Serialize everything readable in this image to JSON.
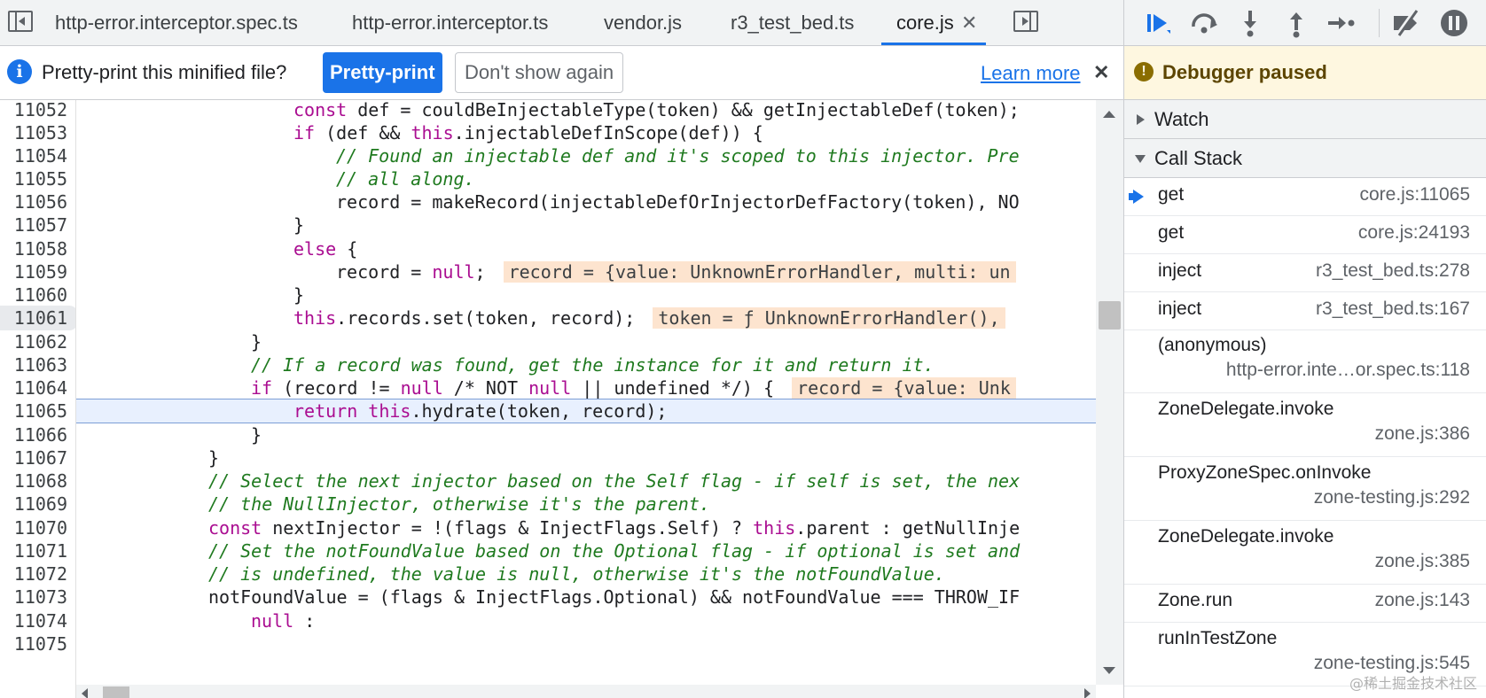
{
  "editor": {
    "tabs": [
      {
        "label": "http-error.interceptor.spec.ts",
        "active": false
      },
      {
        "label": "http-error.interceptor.ts",
        "active": false
      },
      {
        "label": "vendor.js",
        "active": false
      },
      {
        "label": "r3_test_bed.ts",
        "active": false
      },
      {
        "label": "core.js",
        "active": true
      }
    ],
    "tab_close_glyph": "✕",
    "left_toggle_icon": "toggle-navigator-icon",
    "right_toggle_icon": "toggle-debugger-icon"
  },
  "infobar": {
    "icon": "info-icon",
    "icon_glyph": "i",
    "message": "Pretty-print this minified file?",
    "primary_button": "Pretty-print",
    "secondary_button": "Don't show again",
    "link": "Learn more",
    "close_glyph": "✕"
  },
  "code": {
    "current_line": "11061",
    "line_numbers": [
      "11052",
      "11053",
      "11054",
      "11055",
      "11056",
      "11057",
      "11058",
      "11059",
      "11060",
      "11061",
      "11062",
      "11063",
      "11064",
      "11065",
      "11066",
      "11067",
      "11068",
      "11069",
      "11070",
      "11071",
      "11072",
      "11073",
      "11074",
      "11075"
    ],
    "lines": [
      "const def = couldBeInjectableType(token) && getInjectableDef(token);",
      "if (def && this.injectableDefInScope(def)) {",
      "// Found an injectable def and it's scoped to this injector. Pre",
      "// all along.",
      "record = makeRecord(injectableDefOrInjectorDefFactory(token), NO",
      "}",
      "else {",
      "record = null;",
      "}",
      "this.records.set(token, record);",
      "}",
      "// If a record was found, get the instance for it and return it.",
      "if (record != null /* NOT null || undefined */) {",
      "return this.hydrate(token, record);",
      "}",
      "}",
      "// Select the next injector based on the Self flag - if self is set, the nex",
      "// the NullInjector, otherwise it's the parent.",
      "const nextInjector = !(flags & InjectFlags.Self) ? this.parent : getNullInje",
      "// Set the notFoundValue based on the Optional flag - if optional is set and",
      "// is undefined, the value is null, otherwise it's the notFoundValue.",
      "notFoundValue = (flags & InjectFlags.Optional) && notFoundValue === THROW_IF",
      "null :",
      ""
    ],
    "inline_values": {
      "l11059": "record = {value: UnknownErrorHandler, multi: un",
      "l11061": "token = ƒ UnknownErrorHandler(),",
      "l11064": "record = {value: Unk"
    }
  },
  "debugger": {
    "toolbar_icons": [
      "resume-icon",
      "step-over-icon",
      "step-into-icon",
      "step-out-icon",
      "step-icon",
      "deactivate-breakpoints-icon",
      "pause-on-exceptions-icon"
    ],
    "paused_text": "Debugger paused",
    "watch_label": "Watch",
    "call_stack_label": "Call Stack",
    "frames": [
      {
        "name": "get",
        "loc": "core.js:11065",
        "current": true
      },
      {
        "name": "get",
        "loc": "core.js:24193"
      },
      {
        "name": "inject",
        "loc": "r3_test_bed.ts:278"
      },
      {
        "name": "inject",
        "loc": "r3_test_bed.ts:167"
      },
      {
        "name": "(anonymous)",
        "loc": "http-error.inte…or.spec.ts:118"
      },
      {
        "name": "ZoneDelegate.invoke",
        "loc": "zone.js:386"
      },
      {
        "name": "ProxyZoneSpec.onInvoke",
        "loc": "zone-testing.js:292"
      },
      {
        "name": "ZoneDelegate.invoke",
        "loc": "zone.js:385"
      },
      {
        "name": "Zone.run",
        "loc": "zone.js:143"
      },
      {
        "name": "runInTestZone",
        "loc": "zone-testing.js:545"
      }
    ]
  },
  "watermark": "@稀土掘金技术社区",
  "colors": {
    "accent": "#1a73e8",
    "paused_bg": "#fef7e0",
    "inline_value_bg": "#fde4cf",
    "keyword": "#aa0d91",
    "variable": "#1a1aa6",
    "comment": "#1f7a1f"
  }
}
